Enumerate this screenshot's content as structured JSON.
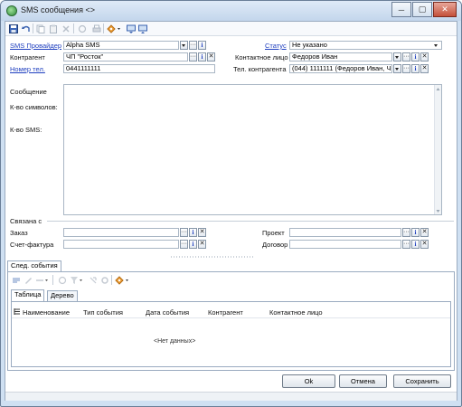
{
  "window": {
    "title": "SMS сообщения <>",
    "buttons": {
      "minimize": "─",
      "maximize": "▢",
      "close": "✕"
    }
  },
  "toolbar": {
    "icons": [
      "save-icon",
      "undo-icon",
      "copy-icon",
      "paste-icon",
      "delete-icon",
      "refresh-icon",
      "print-icon",
      "actions-menu-icon",
      "send-icon",
      "receive-icon"
    ]
  },
  "form": {
    "sms_provider": {
      "label": "SMS Провайдер",
      "value": "Alpha SMS"
    },
    "counterparty": {
      "label": "Контрагент",
      "value": "ЧП \"Росток\""
    },
    "phone_number": {
      "label": "Номер тел.",
      "value": "0441111111"
    },
    "status": {
      "label": "Статус",
      "value": "Не указано"
    },
    "contact_person": {
      "label": "Контактное лицо",
      "value": "Федоров Иван"
    },
    "counterparty_phone": {
      "label": "Тел. контрагента",
      "value": "(044) 1111111 (Федоров Иван, Ч"
    },
    "message_label": "Сообщение",
    "char_count_label": "К-во символов:",
    "sms_count_label": "К-во SMS:",
    "message_text": ""
  },
  "related": {
    "section_label": "Связана с",
    "order": {
      "label": "Заказ",
      "value": ""
    },
    "invoice": {
      "label": "Счет-фактура",
      "value": ""
    },
    "project": {
      "label": "Проект",
      "value": ""
    },
    "contract": {
      "label": "Договор",
      "value": ""
    }
  },
  "glyphs": {
    "ellipsis": "···",
    "info": "i",
    "clear": "✕"
  },
  "events": {
    "tab_label": "След. события",
    "view_tabs": [
      "Таблица",
      "Дерево"
    ],
    "columns": [
      "Наименование",
      "Тип события",
      "Дата события",
      "Контрагент",
      "Контактное лицо"
    ],
    "empty_text": "<Нет данных>"
  },
  "footer": {
    "ok": "Ok",
    "cancel": "Отмена",
    "save": "Сохранить"
  }
}
